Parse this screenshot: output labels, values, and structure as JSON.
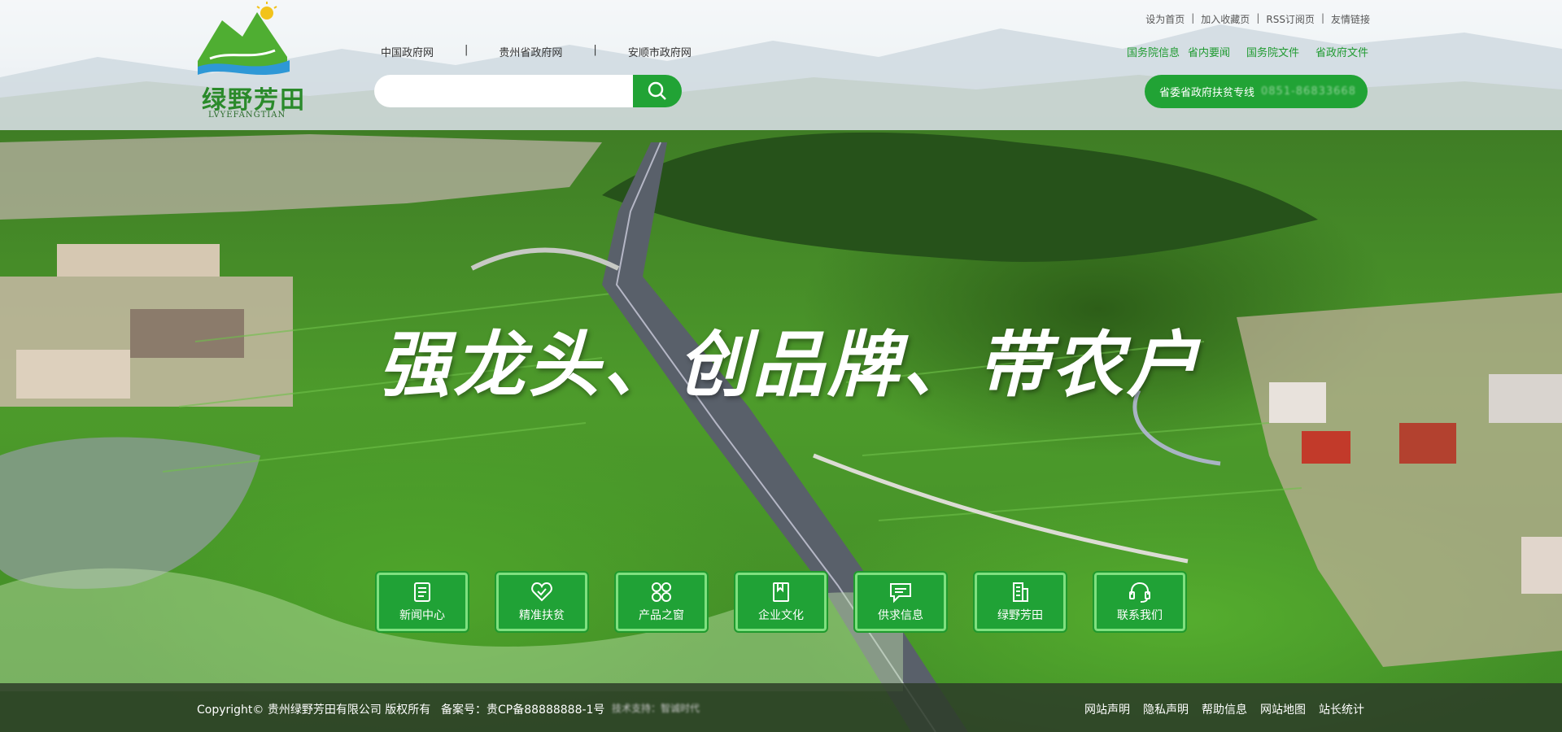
{
  "top_util": [
    "设为首页",
    "加入收藏页",
    "RSS订阅页",
    "友情链接"
  ],
  "gov_links": [
    "中国政府网",
    "贵州省政府网",
    "安顺市政府网"
  ],
  "news_links": [
    "国务院信息",
    "省内要闻",
    "国务院文件",
    "省政府文件"
  ],
  "search": {
    "placeholder": ""
  },
  "hotline": {
    "label": "省委省政府扶贫专线",
    "number": "0851-86833668"
  },
  "logo": {
    "brand": "绿野芳田",
    "brand_en": "LVYEFANGTIAN"
  },
  "slogan": "强龙头、创品牌、带农户",
  "tiles": [
    {
      "label": "新闻中心",
      "icon": "news-icon"
    },
    {
      "label": "精准扶贫",
      "icon": "heart-icon"
    },
    {
      "label": "产品之窗",
      "icon": "grid-icon"
    },
    {
      "label": "企业文化",
      "icon": "book-icon"
    },
    {
      "label": "供求信息",
      "icon": "message-icon"
    },
    {
      "label": "绿野芳田",
      "icon": "building-icon"
    },
    {
      "label": "联系我们",
      "icon": "headset-icon"
    }
  ],
  "footer": {
    "copyright": "Copyright© 贵州绿野芳田有限公司 版权所有",
    "icp": "备案号：贵CP备88888888-1号",
    "tech": "技术支持：智诚时代",
    "links": [
      "网站声明",
      "隐私声明",
      "帮助信息",
      "网站地图",
      "站长统计"
    ]
  },
  "colors": {
    "brand_green": "#21a335",
    "tile_border": "#7fe07f",
    "footer_bg": "#2d3c28"
  }
}
